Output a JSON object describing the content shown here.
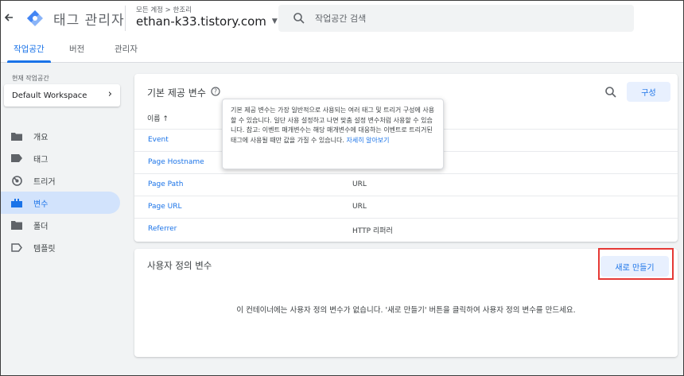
{
  "header": {
    "app_title": "태그 관리자",
    "breadcrumb": "모든 계정 > 한조리",
    "container_name": "ethan-k33.tistory.com",
    "search_placeholder": "작업공간 검색"
  },
  "tabs": [
    {
      "label": "작업공간",
      "active": true
    },
    {
      "label": "버전",
      "active": false
    },
    {
      "label": "관리자",
      "active": false
    }
  ],
  "sidebar": {
    "workspace_label": "현재 작업공간",
    "workspace_name": "Default Workspace",
    "items": [
      {
        "label": "개요",
        "icon": "folder-icon"
      },
      {
        "label": "태그",
        "icon": "tag-icon"
      },
      {
        "label": "트리거",
        "icon": "trigger-icon"
      },
      {
        "label": "변수",
        "icon": "variables-icon",
        "active": true
      },
      {
        "label": "폴더",
        "icon": "folder-icon"
      },
      {
        "label": "템플릿",
        "icon": "template-icon"
      }
    ]
  },
  "builtin_vars": {
    "title": "기본 제공 변수",
    "configure_label": "구성",
    "column_name": "이름 ↑",
    "rows": [
      {
        "name": "Event",
        "type": ""
      },
      {
        "name": "Page Hostname",
        "type": ""
      },
      {
        "name": "Page Path",
        "type": "URL"
      },
      {
        "name": "Page URL",
        "type": "URL"
      },
      {
        "name": "Referrer",
        "type": "HTTP 리퍼러"
      }
    ]
  },
  "tooltip": {
    "text": "기본 제공 변수는 가장 일반적으로 사용되는 여러 태그 및 트리거 구성에 사용할 수 있습니다. 일단 사용 설정하고 나면 맞춤 설정 변수처럼 사용할 수 있습니다. 참고: 이벤트 매개변수는 해당 매개변수에 대응하는 이벤트로 트리거된 태그에 사용될 때만 값을 가질 수 있습니다.",
    "link": "자세히 알아보기"
  },
  "user_vars": {
    "title": "사용자 정의 변수",
    "new_label": "새로 만들기",
    "empty_message": "이 컨테이너에는 사용자 정의 변수가 없습니다. '새로 만들기' 버튼을 클릭하여 사용자 정의 변수를 만드세요."
  },
  "colors": {
    "accent": "#1a73e8",
    "highlight": "#e53935",
    "nav_active_bg": "#d2e3fc"
  }
}
